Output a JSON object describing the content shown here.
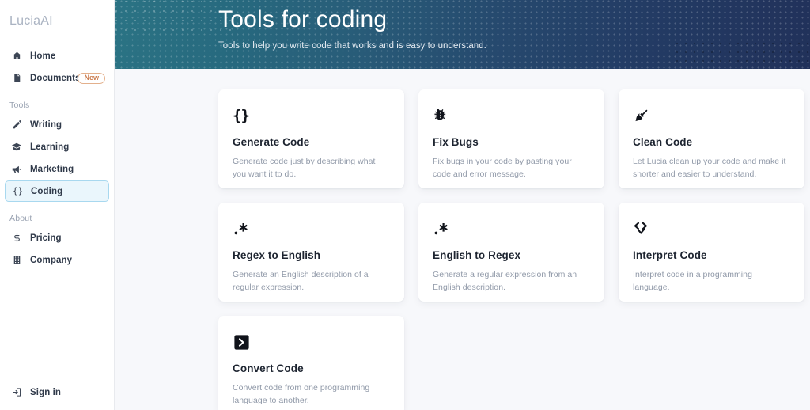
{
  "sidebar": {
    "brand": "LuciaAI",
    "top_items": [
      {
        "label": "Home",
        "icon": "home-icon"
      },
      {
        "label": "Documents",
        "icon": "document-icon",
        "badge": "New"
      }
    ],
    "tools_label": "Tools",
    "tools_items": [
      {
        "label": "Writing",
        "icon": "pencil-icon",
        "active": false
      },
      {
        "label": "Learning",
        "icon": "graduation-cap-icon",
        "active": false
      },
      {
        "label": "Marketing",
        "icon": "megaphone-icon",
        "active": false
      },
      {
        "label": "Coding",
        "icon": "braces-icon",
        "active": true
      }
    ],
    "about_label": "About",
    "about_items": [
      {
        "label": "Pricing",
        "icon": "dollar-icon"
      },
      {
        "label": "Company",
        "icon": "building-icon"
      }
    ],
    "sign_in": {
      "label": "Sign in",
      "icon": "sign-in-icon"
    }
  },
  "hero": {
    "title": "Tools for coding",
    "subtitle": "Tools to help you write code that works and is easy to understand."
  },
  "cards": [
    {
      "icon": "braces-icon",
      "title": "Generate Code",
      "description": "Generate code just by describing what you want it to do."
    },
    {
      "icon": "bug-icon",
      "title": "Fix Bugs",
      "description": "Fix bugs in your code by pasting your code and error message."
    },
    {
      "icon": "broom-icon",
      "title": "Clean Code",
      "description": "Let Lucia clean up your code and make it shorter and easier to understand."
    },
    {
      "icon": "regex-icon",
      "title": "Regex to English",
      "description": "Generate an English description of a regular expression."
    },
    {
      "icon": "regex-icon",
      "title": "English to Regex",
      "description": "Generate a regular expression from an English description."
    },
    {
      "icon": "code-check-icon",
      "title": "Interpret Code",
      "description": "Interpret code in a programming language."
    },
    {
      "icon": "terminal-icon",
      "title": "Convert Code",
      "description": "Convert code from one programming language to another."
    }
  ],
  "colors": {
    "hero_gradient_start": "#2b7384",
    "hero_gradient_end": "#21315a",
    "active_nav_bg": "#eaf6fc",
    "active_nav_border": "#a8d8ef",
    "badge_new": "#cb7d4f",
    "page_bg": "#f7f8fb"
  }
}
